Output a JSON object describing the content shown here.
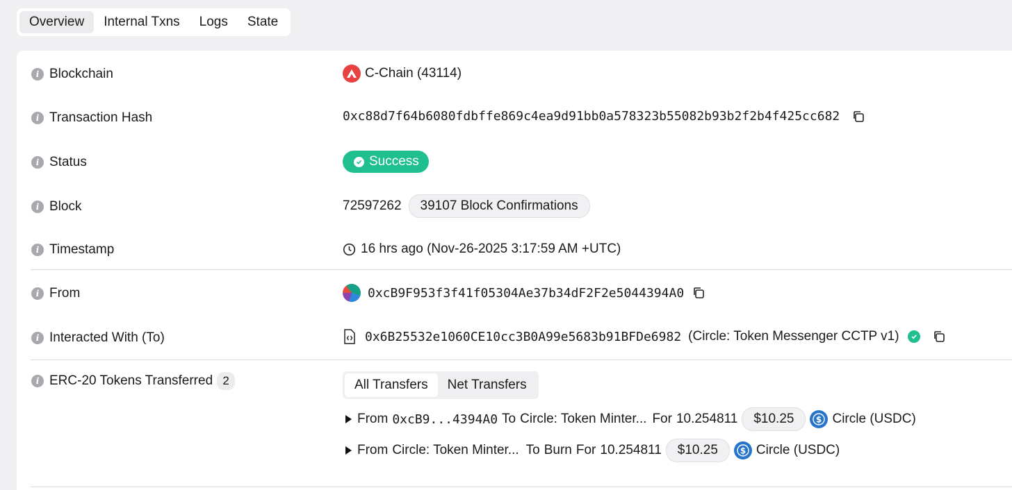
{
  "tabs": [
    "Overview",
    "Internal Txns",
    "Logs",
    "State"
  ],
  "blockchain": {
    "label": "Blockchain",
    "value": "C-Chain (43114)"
  },
  "tx_hash": {
    "label": "Transaction Hash",
    "value": "0xc88d7f64b6080fdbffe869c4ea9d91bb0a578323b55082b93b2f2b4f425cc682"
  },
  "status": {
    "label": "Status",
    "value": "Success",
    "color": "#1fbf8f"
  },
  "block": {
    "label": "Block",
    "value": "72597262",
    "confirmations": "39107 Block Confirmations"
  },
  "timestamp": {
    "label": "Timestamp",
    "value": "16 hrs ago (Nov-26-2025 3:17:59 AM +UTC)"
  },
  "from": {
    "label": "From",
    "value": "0xcB9F953f3f41f05304Ae37b34dF2F2e5044394A0"
  },
  "to": {
    "label": "Interacted With (To)",
    "value": "0x6B25532e1060CE10cc3B0A99e5683b91BFDe6982",
    "name": "(Circle: Token Messenger CCTP v1)"
  },
  "tokens": {
    "label": "ERC-20 Tokens Transferred",
    "count": "2",
    "tabs": [
      "All Transfers",
      "Net Transfers"
    ],
    "transfers": [
      {
        "from_kw": "From",
        "from": "0xcB9...4394A0",
        "to_kw": "To",
        "to": "Circle: Token Minter...",
        "for_kw": "For",
        "amount": "10.254811",
        "usd": "$10.25",
        "token": "Circle (USDC)"
      },
      {
        "from_kw": "From",
        "from": "Circle: Token Minter...",
        "to_kw": "To",
        "to": "Burn",
        "for_kw": "For",
        "amount": "10.254811",
        "usd": "$10.25",
        "token": "Circle (USDC)"
      }
    ]
  }
}
